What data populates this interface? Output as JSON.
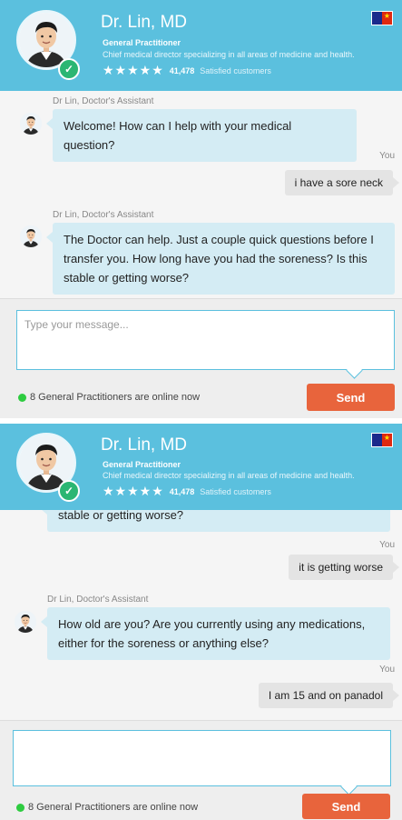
{
  "doctor": {
    "name": "Dr. Lin, MD",
    "specialty": "General Practitioner",
    "description": "Chief medical director specializing in all areas of medicine and health.",
    "stars": "★★★★★",
    "rating_count": "41,478",
    "rating_label": "Satisfied customers"
  },
  "assistant_label": "Dr Lin, Doctor's Assistant",
  "you_label": "You",
  "top_screen": {
    "messages": [
      {
        "from": "assistant",
        "text": "Welcome! How can I help with your medical question?"
      },
      {
        "from": "user",
        "text": "i have a sore neck"
      },
      {
        "from": "assistant",
        "text": "The Doctor can help. Just a couple quick questions before I transfer you. How long have you had the soreness? Is this stable or getting worse?"
      }
    ],
    "input_placeholder": "Type your message..."
  },
  "bottom_screen": {
    "partial_text": "stable or getting worse?",
    "messages": [
      {
        "from": "user",
        "text": "it is getting worse"
      },
      {
        "from": "assistant",
        "text": "How old are you? Are you currently using any medications, either for the soreness or anything else?"
      },
      {
        "from": "user",
        "text": "I am 15 and on panadol"
      }
    ],
    "input_placeholder": ""
  },
  "online_status": "8 General Practitioners are online now",
  "send_label": "Send",
  "colors": {
    "header": "#5bc0de",
    "bubble_in": "#d4ecf4",
    "bubble_out": "#e4e4e4",
    "send": "#e8643c",
    "online_dot": "#2ecc40",
    "verified": "#2bb673"
  }
}
